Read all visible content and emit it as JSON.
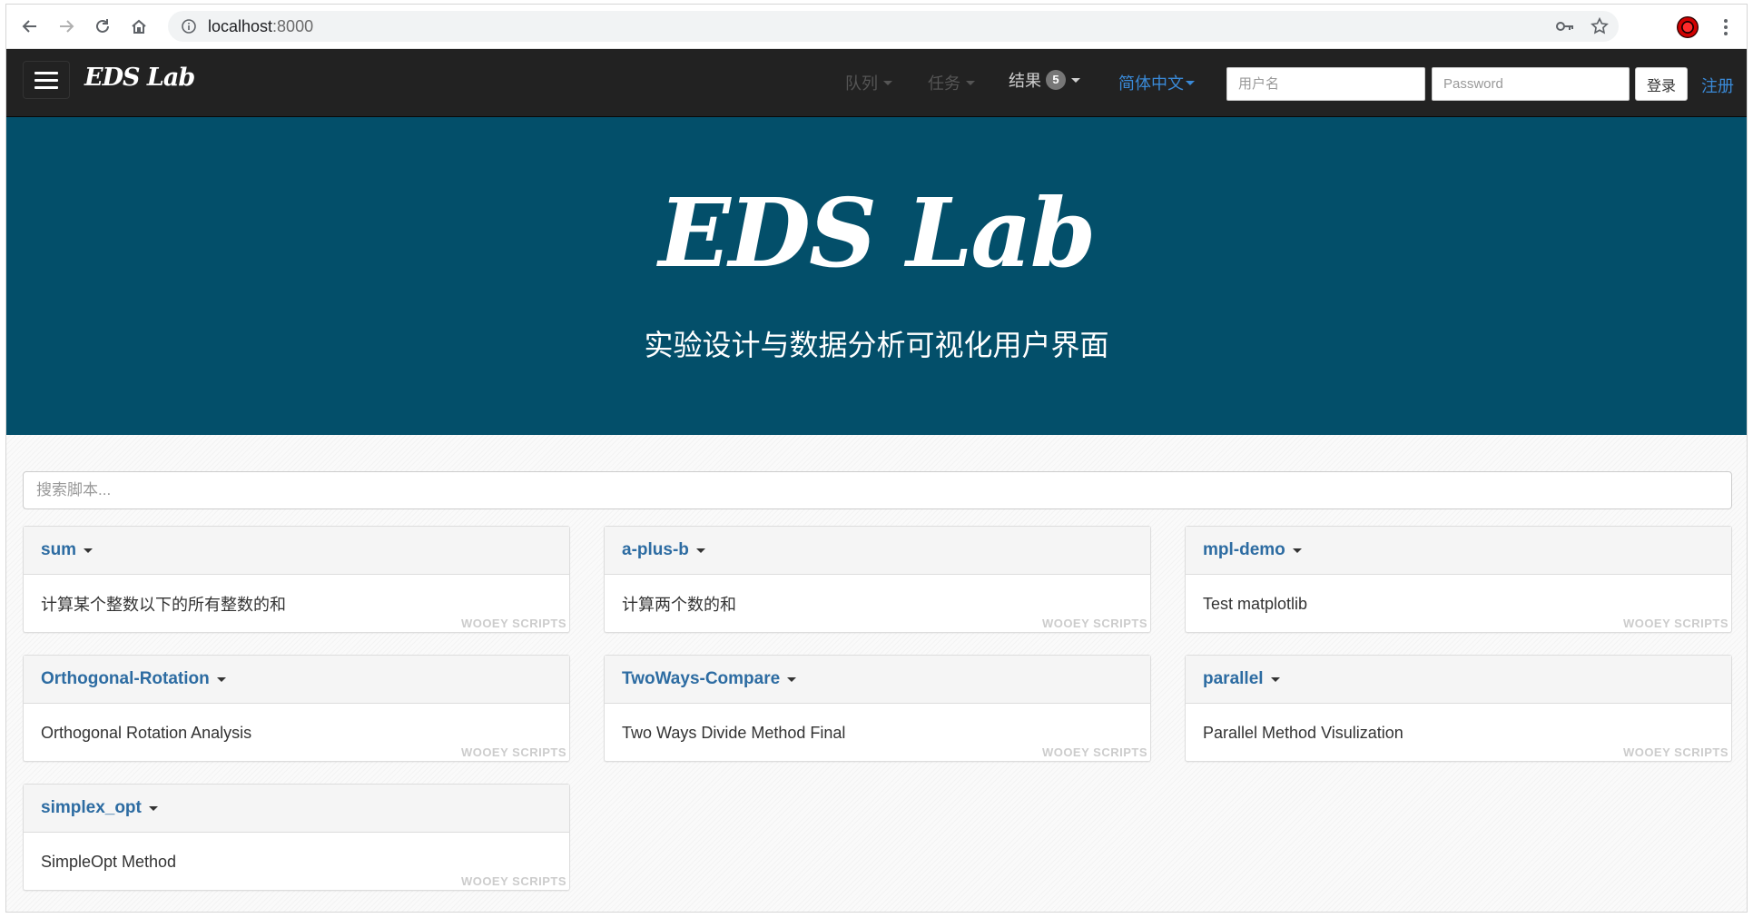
{
  "browser": {
    "url_host": "localhost",
    "url_port": ":8000"
  },
  "navbar": {
    "brand": "EDS Lab",
    "items": [
      {
        "label": "队列"
      },
      {
        "label": "任务"
      },
      {
        "label": "结果",
        "badge": "5"
      },
      {
        "label": "简体中文"
      }
    ],
    "username_placeholder": "用户名",
    "password_placeholder": "Password",
    "login_label": "登录",
    "register_label": "注册"
  },
  "hero": {
    "title": "EDS Lab",
    "subtitle": "实验设计与数据分析可视化用户界面"
  },
  "search": {
    "placeholder": "搜索脚本..."
  },
  "scripts": [
    {
      "name": "sum",
      "description": "计算某个整数以下的所有整数的和",
      "footer": "WOOEY SCRIPTS"
    },
    {
      "name": "a-plus-b",
      "description": "计算两个数的和",
      "footer": "WOOEY SCRIPTS"
    },
    {
      "name": "mpl-demo",
      "description": "Test matplotlib",
      "footer": "WOOEY SCRIPTS"
    },
    {
      "name": "Orthogonal-Rotation",
      "description": "Orthogonal Rotation Analysis",
      "footer": "WOOEY SCRIPTS"
    },
    {
      "name": "TwoWays-Compare",
      "description": "Two Ways Divide Method Final",
      "footer": "WOOEY SCRIPTS"
    },
    {
      "name": "parallel",
      "description": "Parallel Method Visulization",
      "footer": "WOOEY SCRIPTS"
    },
    {
      "name": "simplex_opt",
      "description": "SimpleOpt Method",
      "footer": "WOOEY SCRIPTS"
    }
  ],
  "colors": {
    "navbar": "#222222",
    "hero": "#034f6a",
    "link": "#2d6ca2"
  }
}
